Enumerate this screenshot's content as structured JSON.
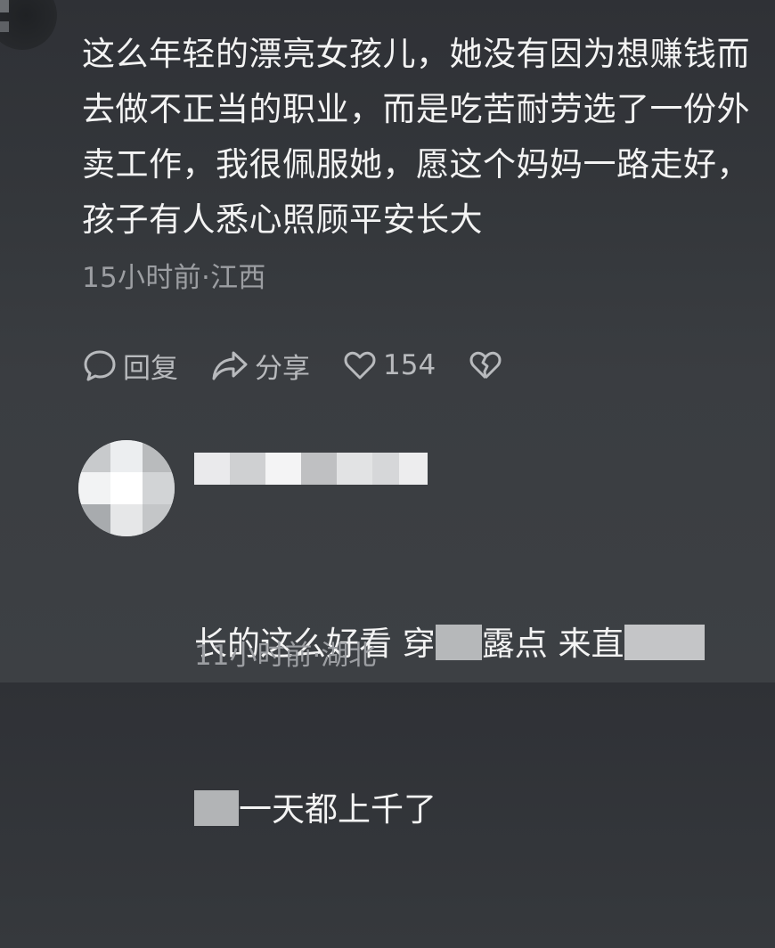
{
  "comment": {
    "text": "这么年轻的漂亮女孩儿，她没有因为想赚钱而去做不正当的职业，而是吃苦耐劳选了一份外卖工作，我很佩服她，愿这个妈妈一路走好，孩子有人悉心照顾平安长大",
    "meta": "15小时前·江西"
  },
  "actions": {
    "reply_label": "回复",
    "share_label": "分享",
    "like_count": "154",
    "reply_icon": "chat-bubble-icon",
    "share_icon": "share-arrow-icon",
    "like_icon": "heart-icon",
    "dislike_icon": "broken-heart-icon"
  },
  "reply": {
    "text_line1": "长的这么好看 穿",
    "text_line1b": "露点 来直",
    "text_line2": "一天都上千了",
    "meta": "11小时前·湖北"
  },
  "colors": {
    "background": "#34373b",
    "text": "#f3f3f3",
    "secondary_text": "#9c9ea2",
    "icon": "#b8babd"
  }
}
